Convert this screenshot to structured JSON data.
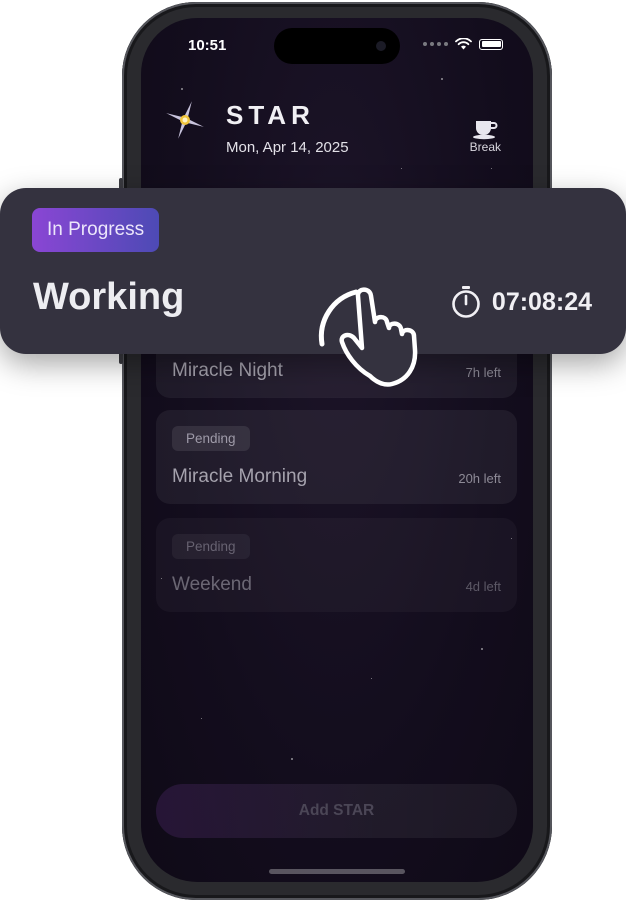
{
  "status_bar": {
    "time": "10:51"
  },
  "app": {
    "title": "STAR",
    "date": "Mon, Apr 14, 2025"
  },
  "break_button": {
    "label": "Break",
    "icon": "coffee-cup-icon"
  },
  "active_task": {
    "status": "In Progress",
    "title": "Working",
    "timer": "07:08:24",
    "timer_icon": "stopwatch-icon",
    "accent_gradient": [
      "#8a46d4",
      "#4d4ab5"
    ]
  },
  "tasks": [
    {
      "title": "Miracle Night",
      "time_left": "7h left"
    },
    {
      "status": "Pending",
      "title": "Miracle Morning",
      "time_left": "20h left"
    },
    {
      "status": "Pending",
      "title": "Weekend",
      "time_left": "4d left"
    }
  ],
  "add_button": {
    "label": "Add STAR"
  },
  "colors": {
    "screen_bg": "#130d1d",
    "card_bg": "#34323f",
    "text": "#ededf1"
  }
}
